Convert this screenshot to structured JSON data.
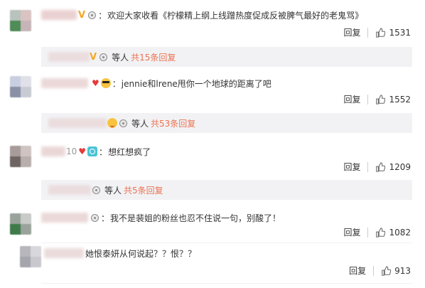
{
  "comments": [
    {
      "text": "欢迎大家收看《柠檬精上纲上线蹭热度促成反被脾气最好的老鬼骂》",
      "reply_label": "回复",
      "likes": "1531",
      "sub": {
        "dengren": "等人",
        "more": "共15条回复"
      }
    },
    {
      "text": "jennie和lrene甩你一个地球的距离了吧",
      "reply_label": "回复",
      "likes": "1552",
      "sub": {
        "dengren": "等人",
        "more": "共53条回复"
      }
    },
    {
      "lead": "10",
      "text": "想红想疯了",
      "reply_label": "回复",
      "likes": "1209",
      "sub": {
        "dengren": "等人",
        "more": "共5条回复"
      }
    },
    {
      "text": "我不是裴姐的粉丝也忍不住说一句，别酸了！",
      "reply_label": "回复",
      "likes": "1082"
    },
    {
      "text": "她恨泰妍从何说起？？恨？？",
      "reply_label": "回复",
      "likes": "913"
    }
  ],
  "colon": "：",
  "icons": [
    "verified-v-icon",
    "medal-icon",
    "thumb-up-icon",
    "cool-emoji-icon",
    "smile-emoji-icon",
    "heart-icon",
    "face-emoji-icon"
  ],
  "colors": {
    "accent": "#eb7350",
    "vip": "#f5a623",
    "subbg": "#f2f2f5"
  }
}
